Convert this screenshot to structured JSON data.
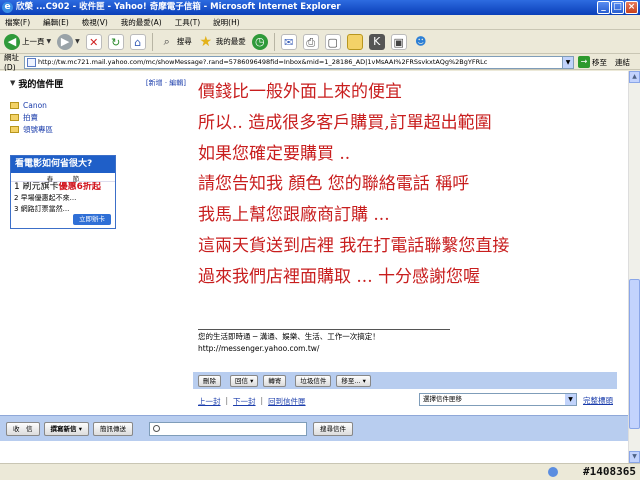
{
  "window": {
    "title": "欣榮 ...C902 - 收件匣 - Yahoo! 奇摩電子信箱 - Microsoft Internet Explorer"
  },
  "menu": [
    "檔案(F)",
    "編輯(E)",
    "檢視(V)",
    "我的最愛(A)",
    "工具(T)",
    "說明(H)"
  ],
  "toolbar": {
    "back_label": "上一頁",
    "search_label": "搜尋",
    "favorites_label": "我的最愛"
  },
  "address": {
    "label": "網址(D)",
    "url": "http://tw.mc721.mail.yahoo.com/mc/showMessage?.rand=5786096498fid=Inbox&mid=1_28186_AD|1vMsAAI%2FRSsvkxtAQg%2BgYFRLc",
    "go_label": "移至",
    "links_label": "連結"
  },
  "sidebar": {
    "folders_title": "我的信件匣",
    "folders_actions": "[新增 · 編輯]",
    "folders": [
      "Canon",
      "拍賣",
      "領號專區"
    ]
  },
  "ad": {
    "headline": "看電影如何省很大?",
    "sub": "春　　　節",
    "row1_prefix": "1 刷元旗卡",
    "row1_hot": "優惠6折起",
    "row2": "2 早場優惠起不來...",
    "row3": "3 網路訂票當然...",
    "button": "立即辦卡"
  },
  "message": {
    "lines": [
      "價錢比一般外面上來的便宜",
      "所以.. 造成很多客戶購買,訂單超出範圍",
      "如果您確定要購買 ..",
      "請您告知我 顏色 您的聯絡電話 稱呼",
      "我馬上幫您跟廠商訂購 ...",
      "這兩天貨送到店裡 我在打電話聯繫您直接",
      "過來我們店裡面購取 ... 十分感謝您喔"
    ],
    "signature1": "您的生活即時通 ─ 溝通、娛樂、生活、工作一次搞定！",
    "signature2": "http://messenger.yahoo.com.tw/"
  },
  "actions": {
    "delete": "刪除",
    "reply": "回信",
    "forward": "轉寄",
    "spam": "垃圾信件",
    "move": "移至..."
  },
  "nav": {
    "prev": "上一封",
    "next": "下一封",
    "back_to_folder": "回到信件匣",
    "folder_select": "選擇信件匣移",
    "full_header": "完整標頭"
  },
  "bottom": {
    "receive": "收　信",
    "compose": "撰寫新信",
    "check_spam": "簡訊傳送",
    "search_btn": "搜尋信件"
  },
  "status": {
    "watermark": "#1408365"
  }
}
